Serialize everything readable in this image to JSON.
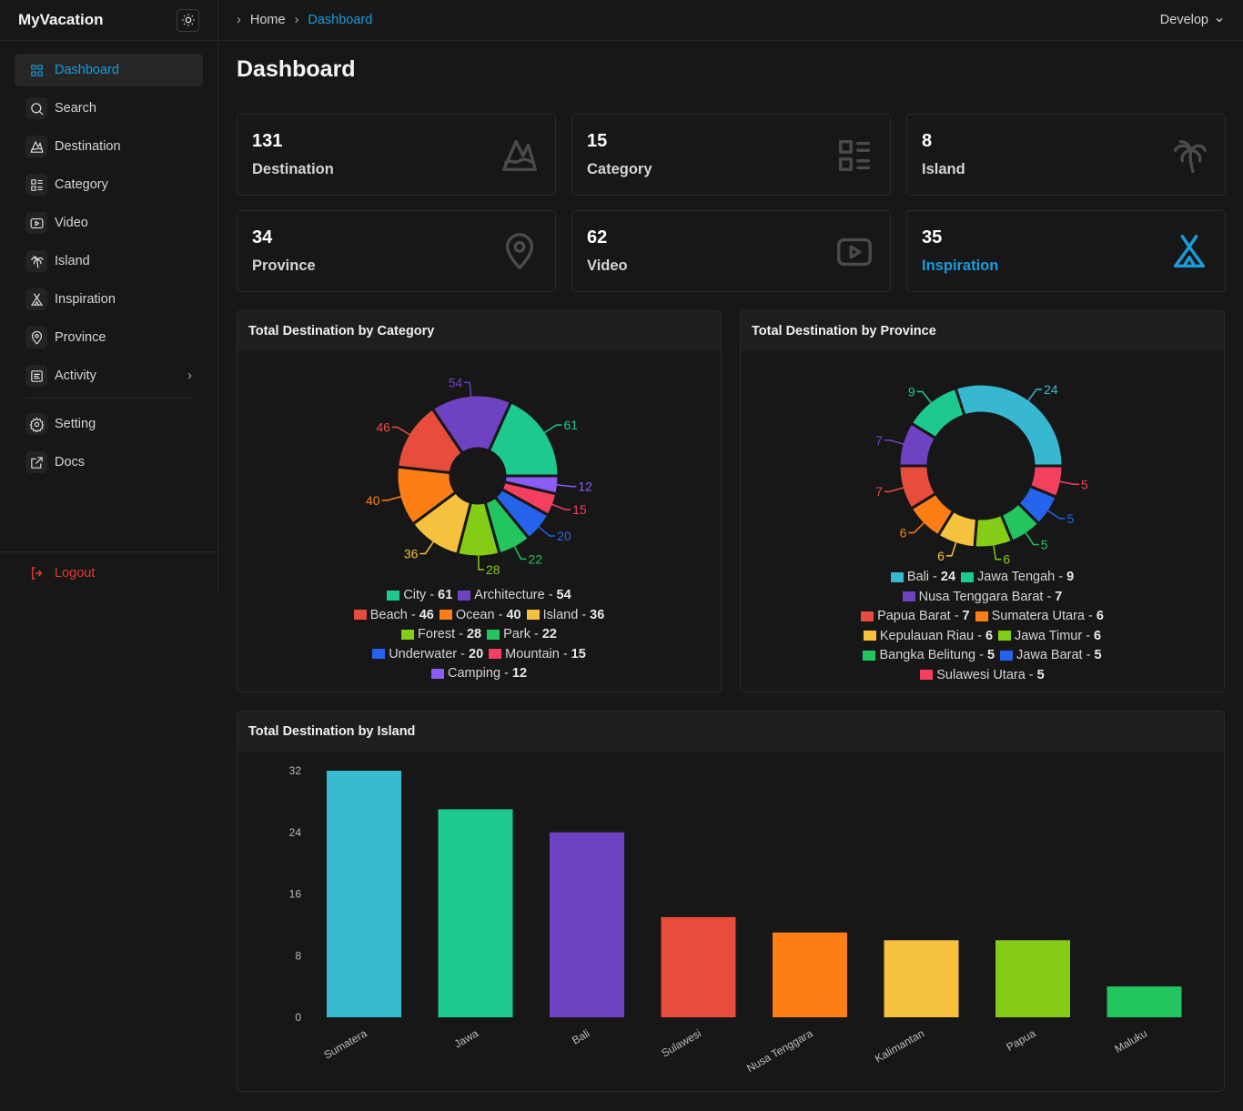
{
  "app": {
    "name": "MyVacation",
    "theme_icon": "sun-icon"
  },
  "sidebar": {
    "items": [
      {
        "label": "Dashboard",
        "icon": "grid-icon",
        "active": true
      },
      {
        "label": "Search",
        "icon": "search-icon"
      },
      {
        "label": "Destination",
        "icon": "mountain-icon"
      },
      {
        "label": "Category",
        "icon": "list-icon"
      },
      {
        "label": "Video",
        "icon": "video-icon"
      },
      {
        "label": "Island",
        "icon": "palm-tree-icon"
      },
      {
        "label": "Inspiration",
        "icon": "tent-icon"
      },
      {
        "label": "Province",
        "icon": "map-pin-icon"
      },
      {
        "label": "Activity",
        "icon": "file-text-icon",
        "has_submenu": true
      }
    ],
    "bottom_items": [
      {
        "label": "Setting",
        "icon": "gear-icon"
      },
      {
        "label": "Docs",
        "icon": "external-link-icon"
      }
    ],
    "logout": "Logout"
  },
  "breadcrumb": [
    "Home",
    "Dashboard"
  ],
  "env_select": "Develop",
  "page_title": "Dashboard",
  "accent": "#1a9bdb",
  "stats": [
    {
      "value": "131",
      "label": "Destination",
      "icon": "mountain-icon"
    },
    {
      "value": "15",
      "label": "Category",
      "icon": "list-icon"
    },
    {
      "value": "8",
      "label": "Island",
      "icon": "palm-tree-icon"
    },
    {
      "value": "34",
      "label": "Province",
      "icon": "map-pin-icon"
    },
    {
      "value": "62",
      "label": "Video",
      "icon": "video-icon"
    },
    {
      "value": "35",
      "label": "Inspiration",
      "icon": "tent-icon",
      "highlight": true
    }
  ],
  "chart_data": [
    {
      "type": "pie",
      "title": "Total Destination by Category",
      "categories": [
        "City",
        "Architecture",
        "Beach",
        "Ocean",
        "Island",
        "Forest",
        "Park",
        "Underwater",
        "Mountain",
        "Camping"
      ],
      "values": [
        61,
        54,
        46,
        40,
        36,
        28,
        22,
        20,
        15,
        12
      ],
      "colors": [
        "#1ec98d",
        "#6f42c1",
        "#e74c3c",
        "#fd7e14",
        "#f6c23e",
        "#84cc16",
        "#22c55e",
        "#2563eb",
        "#f43f5e",
        "#8b5cf6"
      ],
      "legend_rows": [
        [
          0,
          1
        ],
        [
          2,
          3,
          4
        ],
        [
          5,
          6
        ],
        [
          7,
          8
        ],
        [
          9
        ]
      ]
    },
    {
      "type": "pie",
      "title": "Total Destination by Province",
      "categories": [
        "Bali",
        "Jawa Tengah",
        "Nusa Tenggara Barat",
        "Papua Barat",
        "Sumatera Utara",
        "Kepulauan Riau",
        "Jawa Timur",
        "Bangka Belitung",
        "Jawa Barat",
        "Sulawesi Utara"
      ],
      "values": [
        24,
        9,
        7,
        7,
        6,
        6,
        6,
        5,
        5,
        5
      ],
      "colors": [
        "#38b8d0",
        "#1ec98d",
        "#6f42c1",
        "#e74c3c",
        "#fd7e14",
        "#f6c23e",
        "#84cc16",
        "#22c55e",
        "#2563eb",
        "#f43f5e"
      ],
      "legend_rows": [
        [
          0,
          1
        ],
        [
          2
        ],
        [
          3,
          4
        ],
        [
          5,
          6
        ],
        [
          7,
          8
        ],
        [
          9
        ]
      ]
    },
    {
      "type": "bar",
      "title": "Total Destination by Island",
      "categories": [
        "Sumatera",
        "Jawa",
        "Bali",
        "Sulawesi",
        "Nusa Tenggara",
        "Kalimantan",
        "Papua",
        "Maluku"
      ],
      "values": [
        32,
        27,
        24,
        13,
        11,
        10,
        10,
        4
      ],
      "colors": [
        "#38bbcf",
        "#1ec98d",
        "#6f42c1",
        "#e74c3c",
        "#fd7e14",
        "#f6c23e",
        "#84cc16",
        "#22c55e"
      ],
      "yticks": [
        0,
        8,
        16,
        24,
        32
      ],
      "ylim": [
        0,
        32
      ],
      "grid": false
    }
  ]
}
